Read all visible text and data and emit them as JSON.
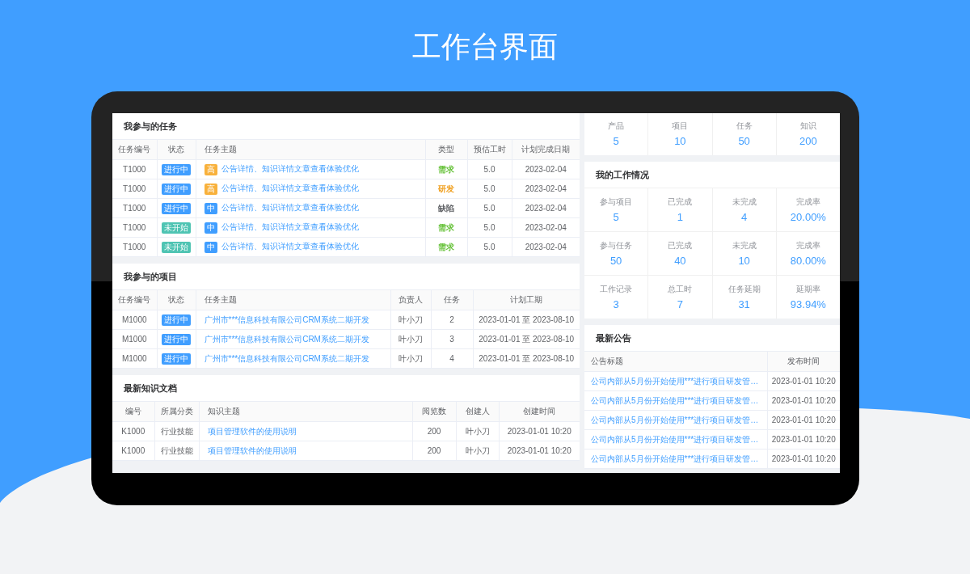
{
  "headline": "工作台界面",
  "tasks": {
    "title": "我参与的任务",
    "columns": [
      "任务编号",
      "状态",
      "任务主题",
      "类型",
      "预估工时",
      "计划完成日期"
    ],
    "rows": [
      {
        "id": "T1000",
        "status": {
          "text": "进行中",
          "color": "#409eff"
        },
        "priority": {
          "text": "高",
          "color": "#f8b13c"
        },
        "subject": "公告详情、知识详情文章查看体验优化",
        "type": {
          "text": "需求",
          "color": "#67c23a"
        },
        "estimate": "5.0",
        "due": "2023-02-04"
      },
      {
        "id": "T1000",
        "status": {
          "text": "进行中",
          "color": "#409eff"
        },
        "priority": {
          "text": "高",
          "color": "#f8b13c"
        },
        "subject": "公告详情、知识详情文章查看体验优化",
        "type": {
          "text": "研发",
          "color": "#f0a020"
        },
        "estimate": "5.0",
        "due": "2023-02-04"
      },
      {
        "id": "T1000",
        "status": {
          "text": "进行中",
          "color": "#409eff"
        },
        "priority": {
          "text": "中",
          "color": "#409eff"
        },
        "subject": "公告详情、知识详情文章查看体验优化",
        "type": {
          "text": "缺陷",
          "color": "#606266"
        },
        "estimate": "5.0",
        "due": "2023-02-04"
      },
      {
        "id": "T1000",
        "status": {
          "text": "未开始",
          "color": "#4fc4b3"
        },
        "priority": {
          "text": "中",
          "color": "#409eff"
        },
        "subject": "公告详情、知识详情文章查看体验优化",
        "type": {
          "text": "需求",
          "color": "#67c23a"
        },
        "estimate": "5.0",
        "due": "2023-02-04"
      },
      {
        "id": "T1000",
        "status": {
          "text": "未开始",
          "color": "#4fc4b3"
        },
        "priority": {
          "text": "中",
          "color": "#409eff"
        },
        "subject": "公告详情、知识详情文章查看体验优化",
        "type": {
          "text": "需求",
          "color": "#67c23a"
        },
        "estimate": "5.0",
        "due": "2023-02-04"
      }
    ]
  },
  "projects": {
    "title": "我参与的项目",
    "columns": [
      "任务编号",
      "状态",
      "任务主题",
      "负责人",
      "任务",
      "计划工期"
    ],
    "rows": [
      {
        "id": "M1000",
        "status": {
          "text": "进行中",
          "color": "#409eff"
        },
        "subject": "广州市***信息科技有限公司CRM系统二期开发",
        "owner": "叶小刀",
        "tasks": "2",
        "period": "2023-01-01 至 2023-08-10"
      },
      {
        "id": "M1000",
        "status": {
          "text": "进行中",
          "color": "#409eff"
        },
        "subject": "广州市***信息科技有限公司CRM系统二期开发",
        "owner": "叶小刀",
        "tasks": "3",
        "period": "2023-01-01 至 2023-08-10"
      },
      {
        "id": "M1000",
        "status": {
          "text": "进行中",
          "color": "#409eff"
        },
        "subject": "广州市***信息科技有限公司CRM系统二期开发",
        "owner": "叶小刀",
        "tasks": "4",
        "period": "2023-01-01 至 2023-08-10"
      }
    ]
  },
  "knowledge": {
    "title": "最新知识文档",
    "columns": [
      "编号",
      "所属分类",
      "知识主题",
      "阅览数",
      "创建人",
      "创建时间"
    ],
    "rows": [
      {
        "id": "K1000",
        "category": "行业技能",
        "subject": "项目管理软件的使用说明",
        "views": "200",
        "creator": "叶小刀",
        "created": "2023-01-01 10:20"
      },
      {
        "id": "K1000",
        "category": "行业技能",
        "subject": "项目管理软件的使用说明",
        "views": "200",
        "creator": "叶小刀",
        "created": "2023-01-01 10:20"
      }
    ]
  },
  "totals": [
    {
      "label": "产品",
      "value": "5"
    },
    {
      "label": "项目",
      "value": "10"
    },
    {
      "label": "任务",
      "value": "50"
    },
    {
      "label": "知识",
      "value": "200"
    }
  ],
  "work_summary": {
    "title": "我的工作情况",
    "rows": [
      [
        {
          "label": "参与项目",
          "value": "5"
        },
        {
          "label": "已完成",
          "value": "1"
        },
        {
          "label": "未完成",
          "value": "4"
        },
        {
          "label": "完成率",
          "value": "20.00%"
        }
      ],
      [
        {
          "label": "参与任务",
          "value": "50"
        },
        {
          "label": "已完成",
          "value": "40"
        },
        {
          "label": "未完成",
          "value": "10"
        },
        {
          "label": "完成率",
          "value": "80.00%"
        }
      ],
      [
        {
          "label": "工作记录",
          "value": "3"
        },
        {
          "label": "总工时",
          "value": "7"
        },
        {
          "label": "任务延期",
          "value": "31"
        },
        {
          "label": "延期率",
          "value": "93.94%"
        }
      ]
    ]
  },
  "notices": {
    "title": "最新公告",
    "columns": [
      "公告标题",
      "发布时间"
    ],
    "rows": [
      {
        "title": "公司内部从5月份开始使用***进行项目研发管…",
        "time": "2023-01-01 10:20"
      },
      {
        "title": "公司内部从5月份开始使用***进行项目研发管…",
        "time": "2023-01-01 10:20"
      },
      {
        "title": "公司内部从5月份开始使用***进行项目研发管…",
        "time": "2023-01-01 10:20"
      },
      {
        "title": "公司内部从5月份开始使用***进行项目研发管…",
        "time": "2023-01-01 10:20"
      },
      {
        "title": "公司内部从5月份开始使用***进行项目研发管…",
        "time": "2023-01-01 10:20"
      }
    ]
  }
}
